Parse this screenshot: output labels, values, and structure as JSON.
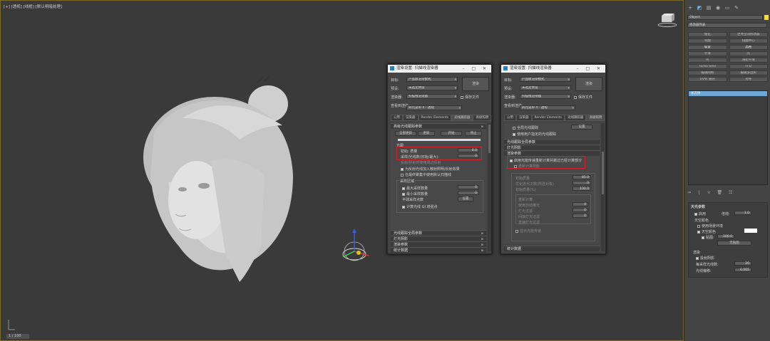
{
  "viewport": {
    "label": "[+] [透视] [线框] [默认明暗处理]",
    "coord_readout": "1 / 100"
  },
  "dialog_left": {
    "title": "渲染设置: 扫描线渲染器",
    "target_label": "目标:",
    "target_value": "产品级渲染模式",
    "preset_label": "预设:",
    "preset_value": "未选定预设",
    "renderer_label": "渲染器:",
    "renderer_value": "扫描线渲染器",
    "save_file_label": "保存文件",
    "view_label": "查看到渲染:",
    "view_value": "四元菜单 4 - 透视",
    "render_button": "渲染",
    "tabs": [
      "公用",
      "渲染器",
      "Render Elements",
      "光线跟踪器",
      "高级照明"
    ],
    "rollup_title": "高级光线跟踪参数",
    "top_buttons": [
      "全部更新",
      "更新",
      "开始",
      "停止"
    ],
    "section_label": "光跟",
    "field1_label": "初始: 质量",
    "field1_value": "0.0",
    "field2_label": "采样/光线数(初始/最大):",
    "field2_value": "0",
    "line3": "反射/折射时使用周边反射",
    "check1": "为反射光线加入散射照明/反射效果",
    "check2": "在最终聚集中使用默认扫描线",
    "group_title": "采样区域",
    "sub1": "最大采样数量",
    "sub1_value": "0",
    "sub2": "最小采样数量",
    "sub2_value": "0",
    "sub3": "半球采样点数",
    "sub3_value": "设置",
    "sub4": "计算光线 GI 增强点",
    "rollups_bottom": [
      "光线跟踪全局参数",
      "灯光阴影",
      "渲染参数",
      "统计数据"
    ]
  },
  "dialog_right": {
    "title": "渲染设置: 扫描线渲染器",
    "target_label": "目标:",
    "target_value": "产品级渲染模式",
    "preset_label": "预设:",
    "preset_value": "未选定预设",
    "renderer_label": "渲染器:",
    "renderer_value": "扫描线渲染器",
    "save_file_label": "保存文件",
    "view_label": "查看到渲染:",
    "view_value": "四元菜单 4 - 透视",
    "render_button": "渲染",
    "tabs": [
      "公用",
      "渲染器",
      "Render Elements",
      "光线跟踪器",
      "高级照明"
    ],
    "row_a": "全局光线跟踪",
    "row_a_button": "设置",
    "row_b": "使用用户指定的光线跟踪",
    "rollup_1": "光线跟踪全局参数",
    "rollup_2": "灯光阴影",
    "rollup_3": "渲染参数",
    "highlight_check": "启用光能传递重新计算并跳过已经计算部分",
    "highlight_sub": "重新计算阴影",
    "body_lines": [
      "初始质量",
      "优化迭代次数(所选对象)",
      "初始质量(%)",
      "重新计算",
      "使用自动曝光",
      "灯光过滤",
      "间接灯光过滤",
      "直接灯光过滤",
      "显示光能传递"
    ],
    "body_values": [
      "85.0",
      "0",
      "100.0",
      "4",
      "0",
      "0"
    ],
    "rollup_bottom": "统计数据"
  },
  "command_panel": {
    "icons": [
      "create-icon",
      "modify-icon",
      "hierarchy-icon",
      "motion-icon",
      "display-icon",
      "utilities-icon"
    ],
    "name_field": "Object",
    "modifier_list": "修改器列表",
    "buttons": [
      "锥化",
      "世界空间修改器",
      "弯曲",
      "扭曲中心",
      "噪波",
      "晶格",
      "平滑",
      "壳",
      "壳",
      "涡轮平滑",
      "Turbo Smo",
      "FFD",
      "编辑网格",
      "编辑多边形",
      "UVW 展开",
      "对称"
    ],
    "stack_item": "长方体",
    "toolbar": [
      "pin-icon",
      "show-end-icon",
      "make-unique-icon",
      "remove-icon",
      "configure-icon"
    ],
    "props_title": "天光参数",
    "props_on": "启用",
    "props_multiplier_label": "倍增:",
    "props_multiplier_value": "1.0",
    "sky_color_label": "天空颜色",
    "use_env_label": "使用场景环境",
    "sky_color_check": "天空颜色",
    "map_label": "贴图:",
    "map_value": "100.0",
    "none_button": "无贴图",
    "render_label": "渲染",
    "cast_shadows": "投射阴影",
    "rays_label": "每采样光线数:",
    "rays_value": "20",
    "bias_label": "光线偏移:",
    "bias_value": "0.005"
  }
}
